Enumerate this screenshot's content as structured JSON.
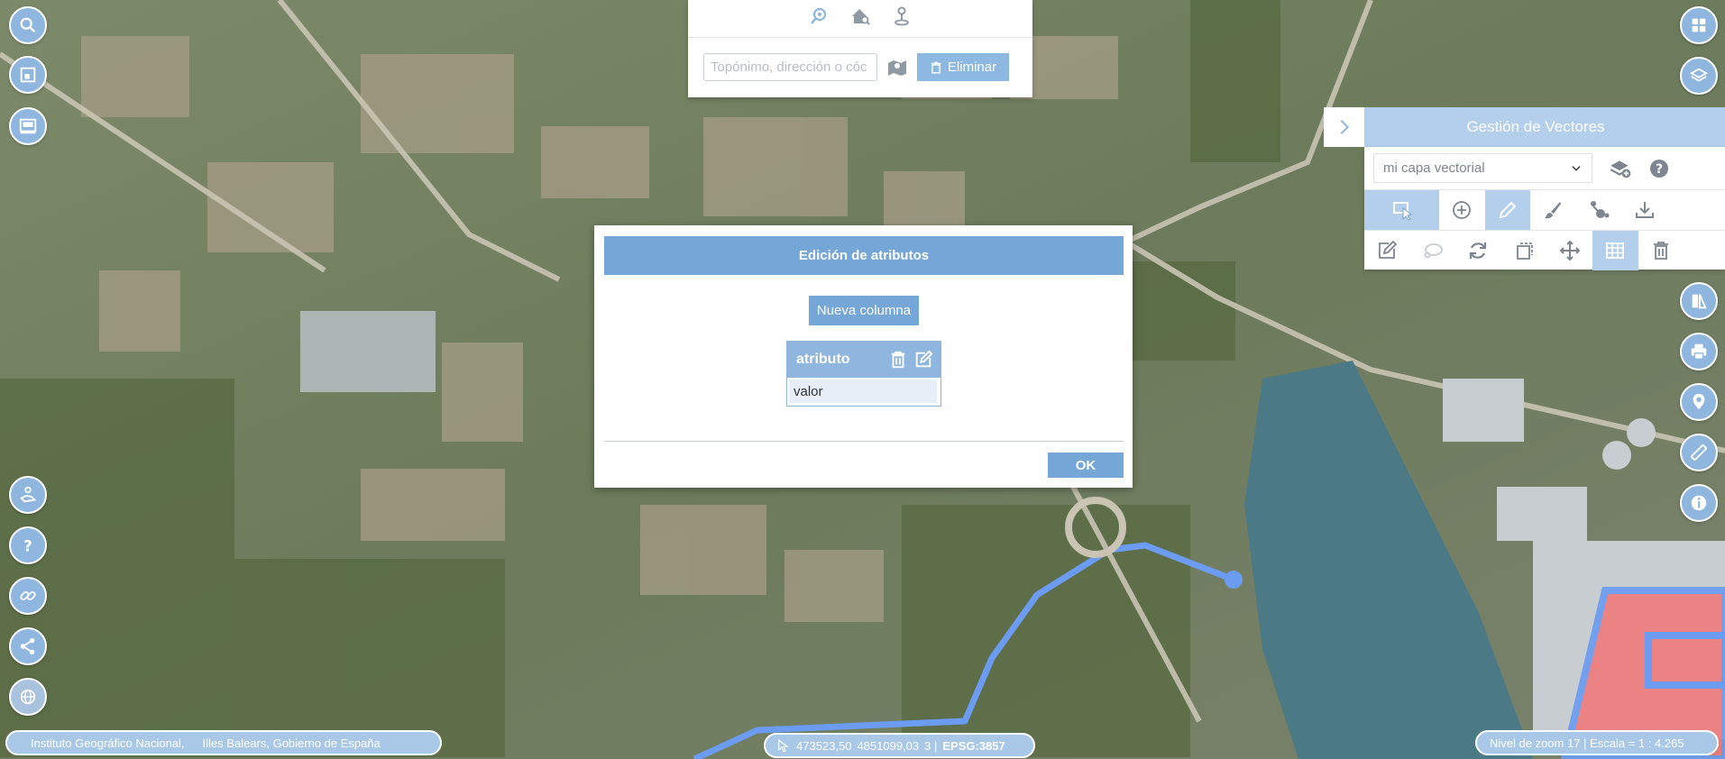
{
  "search": {
    "tabs": [
      "search-place-icon",
      "search-address-icon",
      "search-coordinates-icon"
    ],
    "placeholder": "Topónimo, dirección o cóc",
    "delete_label": "Eliminar"
  },
  "vector_panel": {
    "title": "Gestión de Vectores",
    "layer_selected": "mi capa vectorial",
    "tools_row1": [
      "select",
      "add",
      "edit-draw",
      "style",
      "share",
      "download"
    ],
    "tools_row2": [
      "edit",
      "lasso",
      "refresh",
      "copy",
      "move",
      "table",
      "delete"
    ]
  },
  "modal": {
    "title": "Edición de atributos",
    "new_column_label": "Nueva columna",
    "column_name": "atributo",
    "cell_value": "valor",
    "ok_label": "OK"
  },
  "footer": {
    "attribution_1": "Instituto Geográfico Nacional,",
    "attribution_2": "Illes Balears, Gobierno de España",
    "coord_x": "473523,50",
    "coord_y": "4851099,03",
    "coord_suffix": "3 |",
    "crs": "EPSG:3857",
    "zoom_text": "Nivel de zoom 17 | Escala = 1 : 4.265"
  },
  "colors": {
    "accent": "#74a6d7",
    "button_light": "#8fb6de",
    "header_light": "#b3cfec",
    "route_line": "#6b9cf2",
    "polygon_fill": "#f07c7c"
  }
}
